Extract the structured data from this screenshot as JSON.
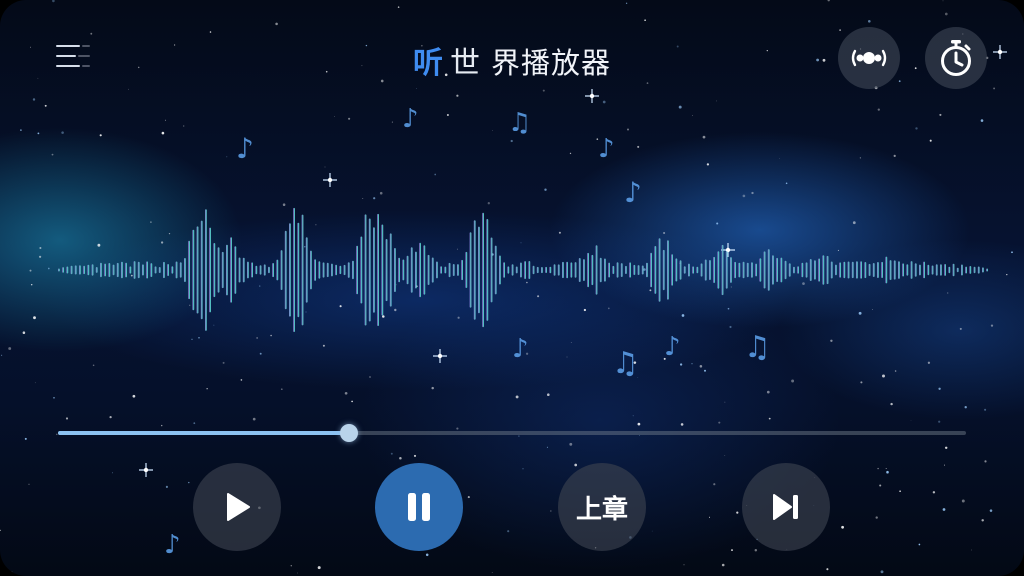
{
  "header": {
    "title_part1": "听",
    "title_part2": "世",
    "title_part3": "界播放器",
    "menu_icon": "menu-icon",
    "broadcast_icon": "broadcast-icon",
    "timer_icon": "timer-icon"
  },
  "playback": {
    "progress": 0.32
  },
  "controls": {
    "play_icon": "play-icon",
    "pause_icon": "pause-icon",
    "previous_chapter_label": "上章",
    "next_icon": "skip-next-icon"
  },
  "colors": {
    "accent": "#3f8cf0",
    "primary_button": "#2c6bb0",
    "progress_fill": "#8cc2f2"
  }
}
